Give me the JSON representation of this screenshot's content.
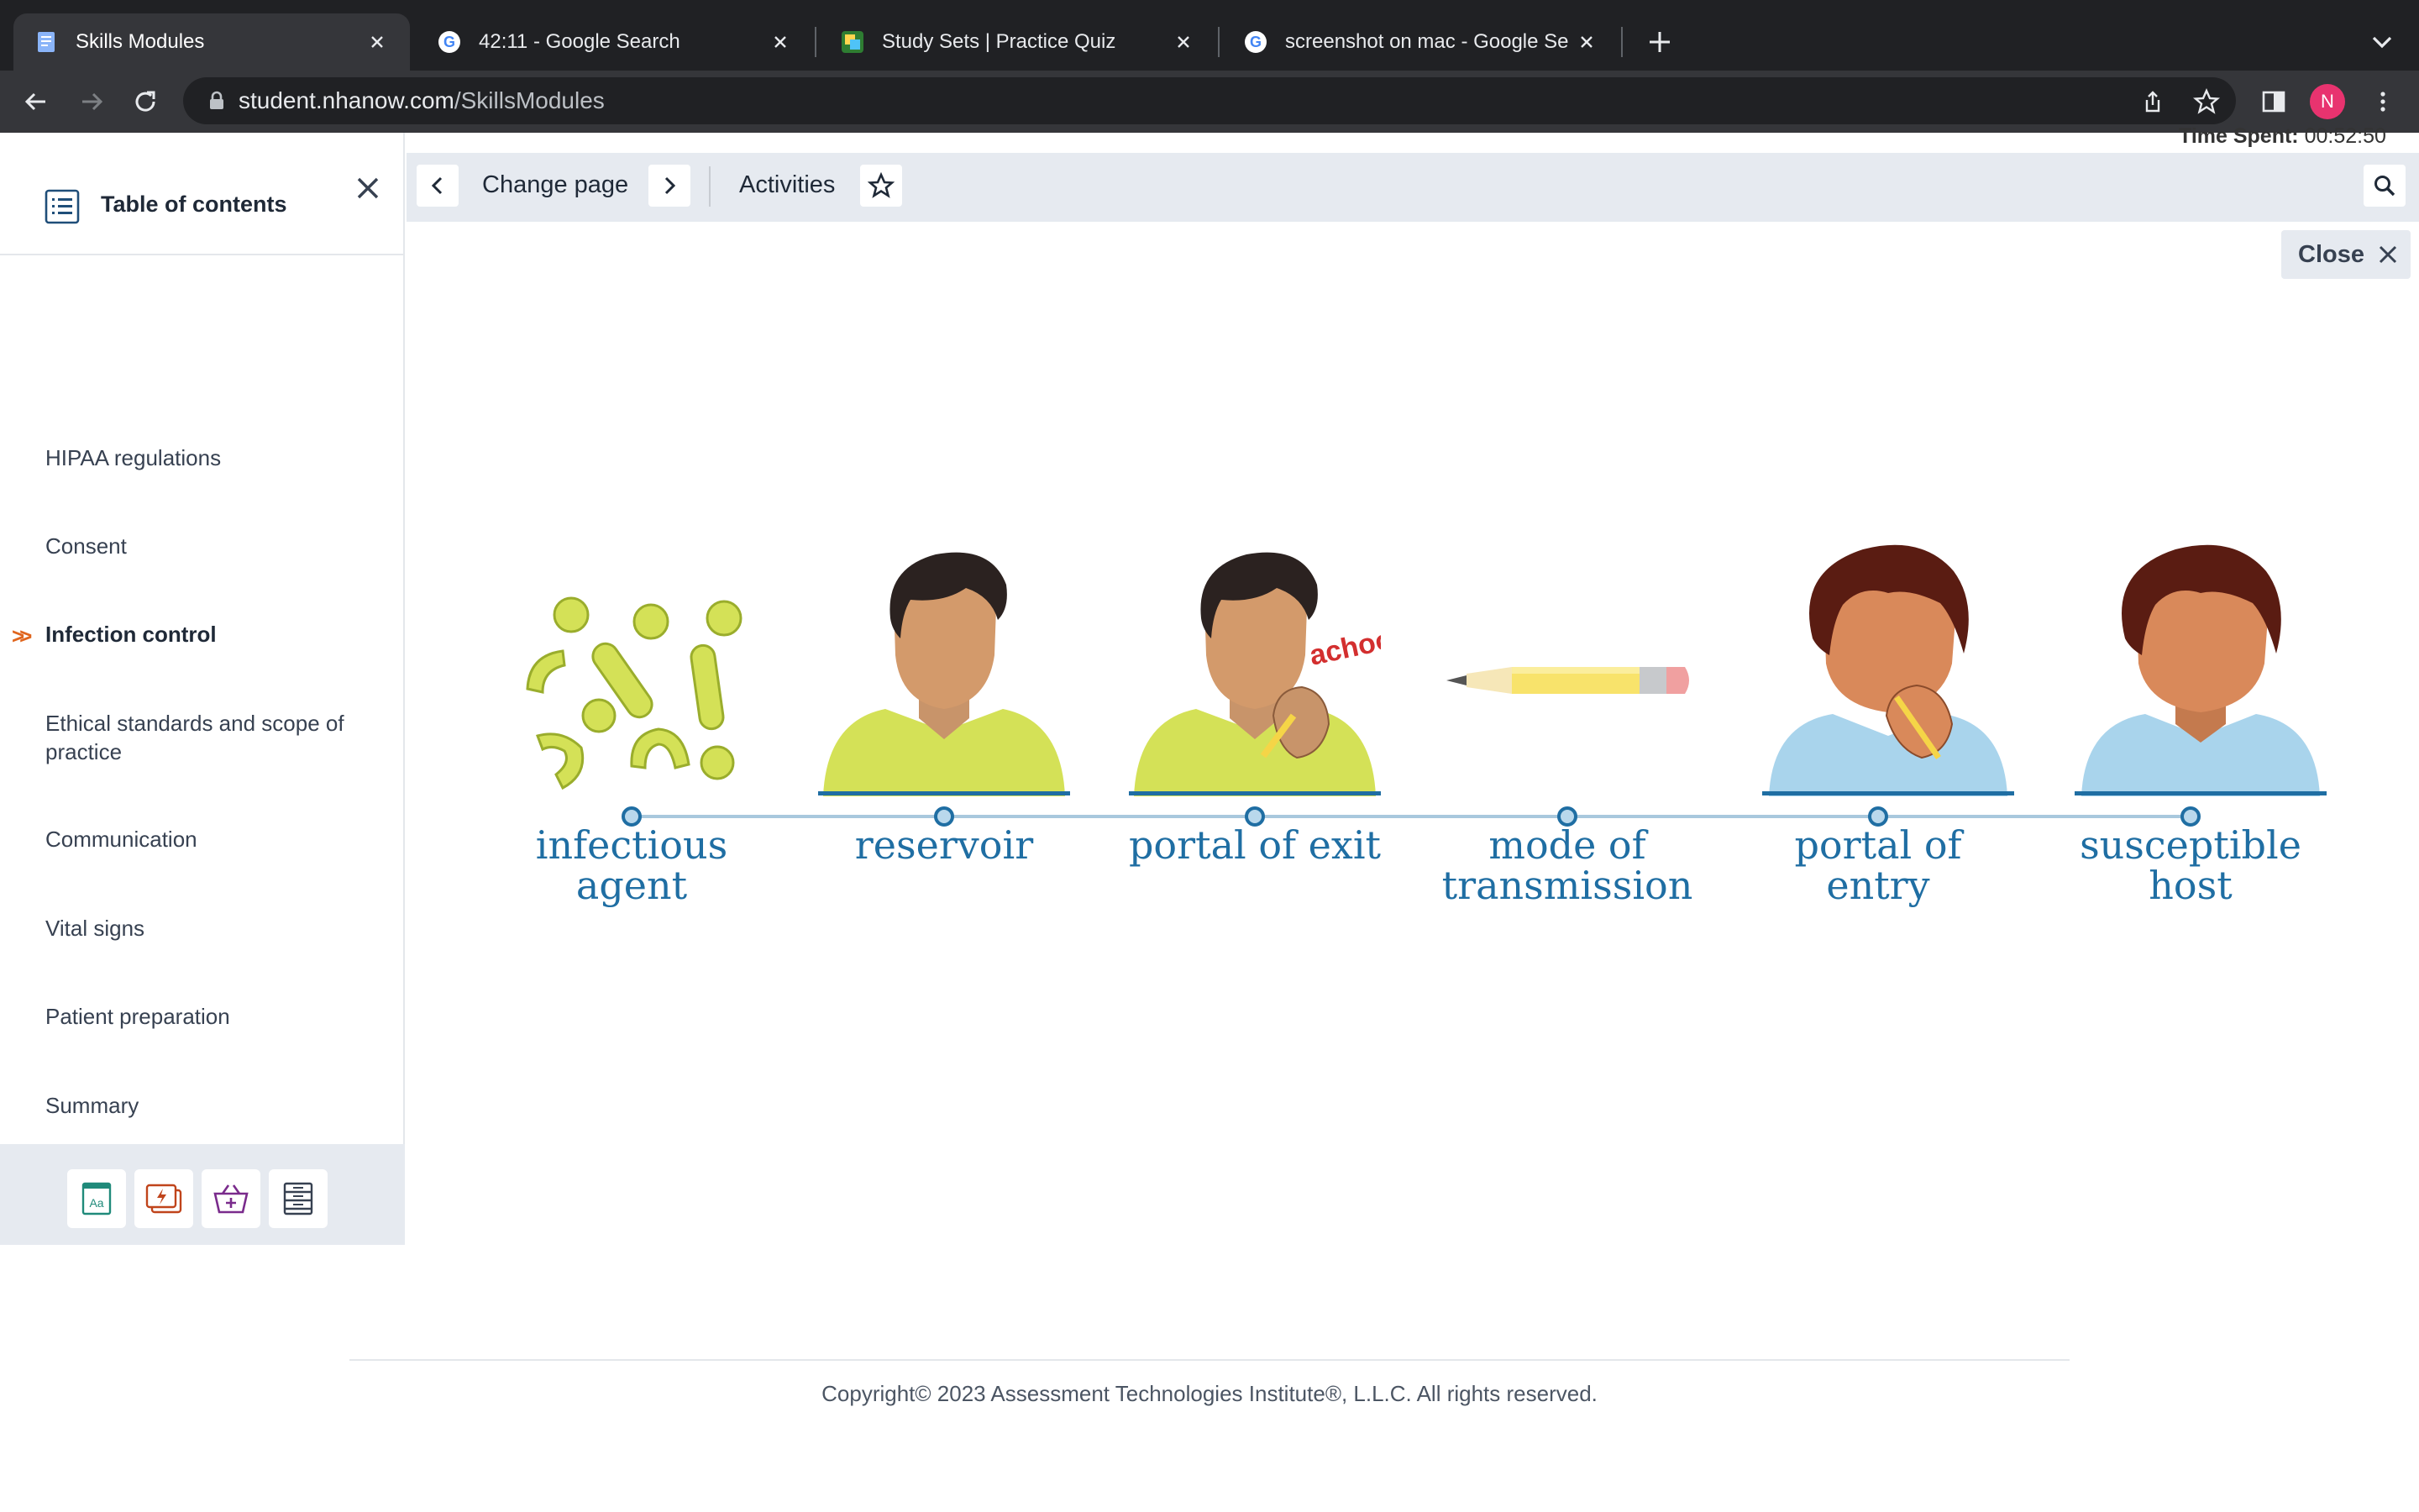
{
  "browser": {
    "tabs": [
      {
        "title": "Skills Modules",
        "active": true,
        "icon": "document-icon"
      },
      {
        "title": "42:11 - Google Search",
        "active": false,
        "icon": "google-icon"
      },
      {
        "title": "Study Sets | Practice Quiz",
        "active": false,
        "icon": "quizlet-icon"
      },
      {
        "title": "screenshot on mac - Google Se",
        "active": false,
        "icon": "google-icon"
      }
    ],
    "url_host": "student.nhanow.com",
    "url_path": "/SkillsModules",
    "profile_initial": "N",
    "profile_color": "#e8336f"
  },
  "time_spent": {
    "label": "Time Spent:",
    "value": "00:52:50"
  },
  "toc": {
    "title": "Table of contents",
    "current_marker": ">>",
    "items": [
      {
        "label": "HIPAA regulations",
        "current": false
      },
      {
        "label": "Consent",
        "current": false
      },
      {
        "label": "Infection control",
        "current": true
      },
      {
        "label": "Ethical standards and scope of practice",
        "current": false
      },
      {
        "label": "Communication",
        "current": false
      },
      {
        "label": "Vital signs",
        "current": false
      },
      {
        "label": "Patient preparation",
        "current": false
      },
      {
        "label": "Summary",
        "current": false
      }
    ],
    "tools": [
      "glossary-icon",
      "flashcards-icon",
      "basket-icon",
      "notes-icon"
    ]
  },
  "pagebar": {
    "change_page": "Change page",
    "activities": "Activities"
  },
  "close_label": "Close",
  "chain": {
    "nodes": [
      {
        "label_lines": [
          "infectious",
          "agent"
        ],
        "icon": "germs-icon"
      },
      {
        "label_lines": [
          "reservoir"
        ],
        "icon": "person-icon"
      },
      {
        "label_lines": [
          "portal of exit"
        ],
        "icon": "sneezing-person-icon"
      },
      {
        "label_lines": [
          "mode of",
          "transmission"
        ],
        "icon": "pencil-icon"
      },
      {
        "label_lines": [
          "portal of entry"
        ],
        "icon": "person-touching-face-icon"
      },
      {
        "label_lines": [
          "susceptible",
          "host"
        ],
        "icon": "host-person-icon"
      }
    ],
    "sneeze_text": "achoo!",
    "label_color": "#1f6ea3"
  },
  "footer": {
    "copyright": "Copyright© 2023 Assessment Technologies Institute®, L.L.C. All rights reserved."
  }
}
